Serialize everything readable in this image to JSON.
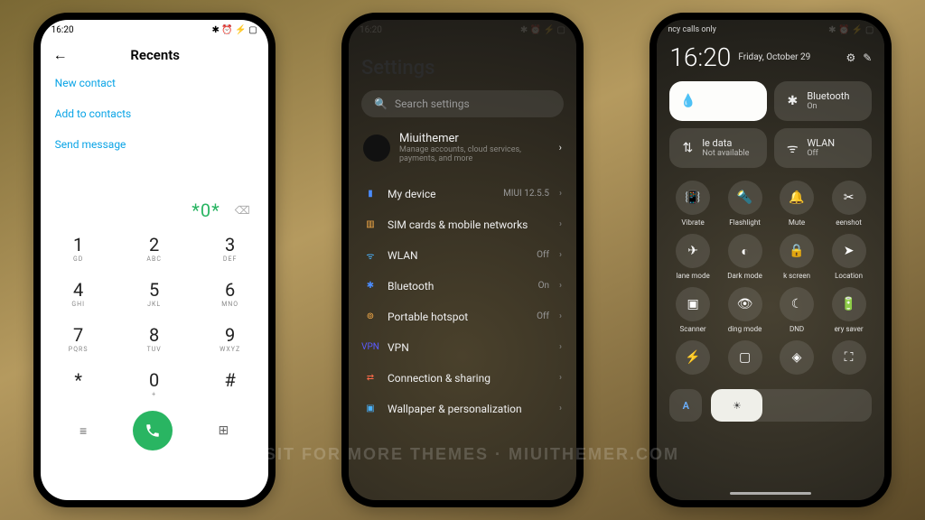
{
  "status": {
    "time": "16:20",
    "icons": "✱ ⏰ ⚡ ▢"
  },
  "phone1": {
    "title": "Recents",
    "links": [
      "New contact",
      "Add to contacts",
      "Send message"
    ],
    "dialed": "*0*",
    "keys": [
      {
        "n": "1",
        "l": "GD"
      },
      {
        "n": "2",
        "l": "ABC"
      },
      {
        "n": "3",
        "l": "DEF"
      },
      {
        "n": "4",
        "l": "GHI"
      },
      {
        "n": "5",
        "l": "JKL"
      },
      {
        "n": "6",
        "l": "MNO"
      },
      {
        "n": "7",
        "l": "PQRS"
      },
      {
        "n": "8",
        "l": "TUV"
      },
      {
        "n": "9",
        "l": "WXYZ"
      },
      {
        "n": "*",
        "l": ""
      },
      {
        "n": "0",
        "l": "+"
      },
      {
        "n": "#",
        "l": ""
      }
    ]
  },
  "phone2": {
    "title": "Settings",
    "search_ph": "Search settings",
    "account": {
      "name": "Miuithemer",
      "sub": "Manage accounts, cloud services, payments, and more"
    },
    "rows": [
      {
        "color": "#4a8cff",
        "icon": "▮",
        "label": "My device",
        "val": "MIUI 12.5.5"
      },
      {
        "color": "#ffb14a",
        "icon": "▥",
        "label": "SIM cards & mobile networks",
        "val": ""
      },
      {
        "color": "#4ab3ff",
        "icon": "ᯤ",
        "label": "WLAN",
        "val": "Off"
      },
      {
        "color": "#4a8cff",
        "icon": "✱",
        "label": "Bluetooth",
        "val": "On"
      },
      {
        "color": "#ffb14a",
        "icon": "⊚",
        "label": "Portable hotspot",
        "val": "Off"
      },
      {
        "color": "#5a5aff",
        "icon": "VPN",
        "label": "VPN",
        "val": ""
      },
      {
        "color": "#ff6b4a",
        "icon": "⇄",
        "label": "Connection & sharing",
        "val": ""
      },
      {
        "color": "#4ab3ff",
        "icon": "▣",
        "label": "Wallpaper & personalization",
        "val": ""
      }
    ]
  },
  "phone3": {
    "carrier": "ncy calls only",
    "time": "16:20",
    "date": "Friday, October 29",
    "tiles": [
      {
        "icon": "💧",
        "title": "",
        "sub": "",
        "state": "on"
      },
      {
        "icon": "✱",
        "title": "Bluetooth",
        "sub": "On",
        "state": "off"
      },
      {
        "icon": "⇅",
        "title": "le data",
        "sub": "Not available",
        "state": "off"
      },
      {
        "icon": "ᯤ",
        "title": "WLAN",
        "sub": "Off",
        "state": "off"
      }
    ],
    "quick": [
      {
        "i": "📳",
        "l": "Vibrate"
      },
      {
        "i": "🔦",
        "l": "Flashlight"
      },
      {
        "i": "🔔",
        "l": "Mute"
      },
      {
        "i": "✂",
        "l": "eenshot"
      },
      {
        "i": "✈",
        "l": "lane mode"
      },
      {
        "i": "◐",
        "l": "Dark mode"
      },
      {
        "i": "🔒",
        "l": "k screen"
      },
      {
        "i": "➤",
        "l": "Location"
      },
      {
        "i": "▣",
        "l": "Scanner"
      },
      {
        "i": "👁",
        "l": "ding mode"
      },
      {
        "i": "☾",
        "l": "DND"
      },
      {
        "i": "🔋",
        "l": "ery saver"
      },
      {
        "i": "⚡",
        "l": ""
      },
      {
        "i": "▢",
        "l": ""
      },
      {
        "i": "◈",
        "l": ""
      },
      {
        "i": "⛶",
        "l": ""
      }
    ],
    "auto": "A"
  },
  "watermark": "VISIT FOR MORE THEMES · MIUITHEMER.COM"
}
